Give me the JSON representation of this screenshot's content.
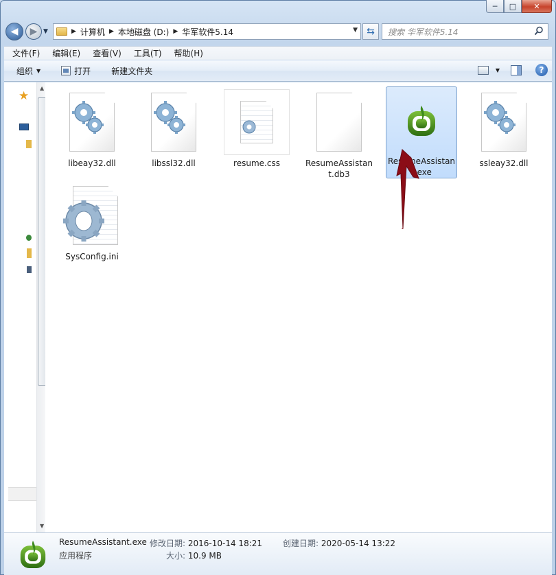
{
  "window": {
    "caption_buttons": {
      "minimize": "─",
      "maximize": "□",
      "close": "✕"
    }
  },
  "address": {
    "crumbs": [
      "计算机",
      "本地磁盘 (D:)",
      "华军软件5.14"
    ],
    "search_placeholder": "搜索 华军软件5.14"
  },
  "menu": [
    "文件(F)",
    "编辑(E)",
    "查看(V)",
    "工具(T)",
    "帮助(H)"
  ],
  "toolbar": {
    "organize": "组织",
    "open": "打开",
    "new_folder": "新建文件夹"
  },
  "files": [
    {
      "name": "libeay32.dll",
      "icon": "dll-gear-icon",
      "selected": false
    },
    {
      "name": "libssl32.dll",
      "icon": "dll-gear-icon",
      "selected": false
    },
    {
      "name": "resume.css",
      "icon": "css-file-icon",
      "selected": false
    },
    {
      "name": "ResumeAssistant.db3",
      "icon": "blank-file-icon",
      "selected": false
    },
    {
      "name": "ResumeAssistant.exe",
      "icon": "app-icon",
      "selected": true
    },
    {
      "name": "ssleay32.dll",
      "icon": "dll-gear-icon",
      "selected": false
    },
    {
      "name": "SysConfig.ini",
      "icon": "ini-gear-icon",
      "selected": false
    }
  ],
  "details": {
    "name": "ResumeAssistant.exe",
    "type": "应用程序",
    "modified_label": "修改日期:",
    "modified": "2016-10-14 18:21",
    "size_label": "大小:",
    "size": "10.9 MB",
    "created_label": "创建日期:",
    "created": "2020-05-14 13:22"
  },
  "colors": {
    "accent": "#2f6db0",
    "app_green": "#3f8a1f",
    "arrow": "#8b0d17"
  }
}
